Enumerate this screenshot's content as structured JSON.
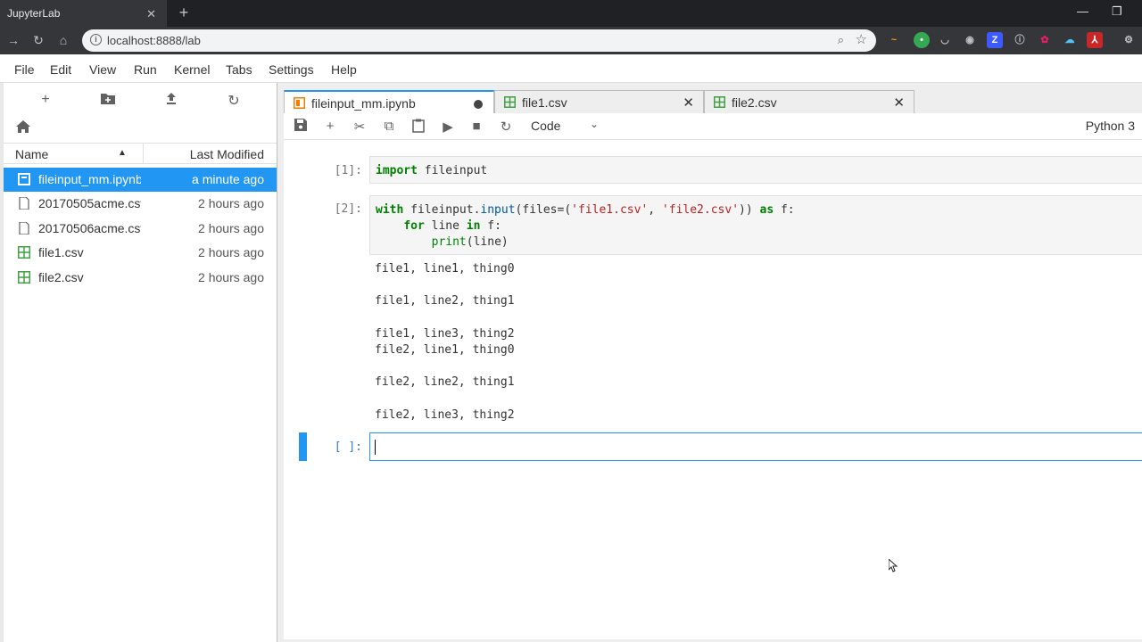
{
  "browser": {
    "tab_title": "JupyterLab",
    "url": "localhost:8888/lab"
  },
  "menu": [
    "File",
    "Edit",
    "View",
    "Run",
    "Kernel",
    "Tabs",
    "Settings",
    "Help"
  ],
  "file_browser": {
    "col_name": "Name",
    "col_modified": "Last Modified",
    "files": [
      {
        "name": "fileinput_mm.ipynb",
        "modified": "a minute ago",
        "type": "notebook"
      },
      {
        "name": "20170505acme.csv",
        "modified": "2 hours ago",
        "type": "file"
      },
      {
        "name": "20170506acme.csv",
        "modified": "2 hours ago",
        "type": "file"
      },
      {
        "name": "file1.csv",
        "modified": "2 hours ago",
        "type": "csv"
      },
      {
        "name": "file2.csv",
        "modified": "2 hours ago",
        "type": "csv"
      }
    ]
  },
  "doc_tabs": [
    {
      "label": "fileinput_mm.ipynb"
    },
    {
      "label": "file1.csv"
    },
    {
      "label": "file2.csv"
    }
  ],
  "toolbar": {
    "cell_type": "Code",
    "kernel": "Python 3"
  },
  "cells": [
    {
      "prompt": "[1]:"
    },
    {
      "prompt": "[2]:"
    },
    {
      "prompt": "[ ]:"
    }
  ],
  "code": {
    "c1_l1_kw": "import",
    "c1_l1_rest": " fileinput",
    "c2_l1": [
      "with",
      " fileinput.",
      "input",
      "(files=(",
      "'file1.csv'",
      ", ",
      "'file2.csv'",
      ")) ",
      "as",
      " f:"
    ],
    "c2_l2": [
      "    ",
      "for",
      " line ",
      "in",
      " f:"
    ],
    "c2_l3": [
      "        ",
      "print",
      "(line)"
    ]
  },
  "output_lines": [
    "file1, line1, thing0",
    "file1, line2, thing1",
    "file1, line3, thing2",
    "file2, line1, thing0",
    "file2, line2, thing1",
    "file2, line3, thing2"
  ],
  "colors": {
    "accent": "#2196f3",
    "keyword": "#008000",
    "string": "#ba2121"
  }
}
